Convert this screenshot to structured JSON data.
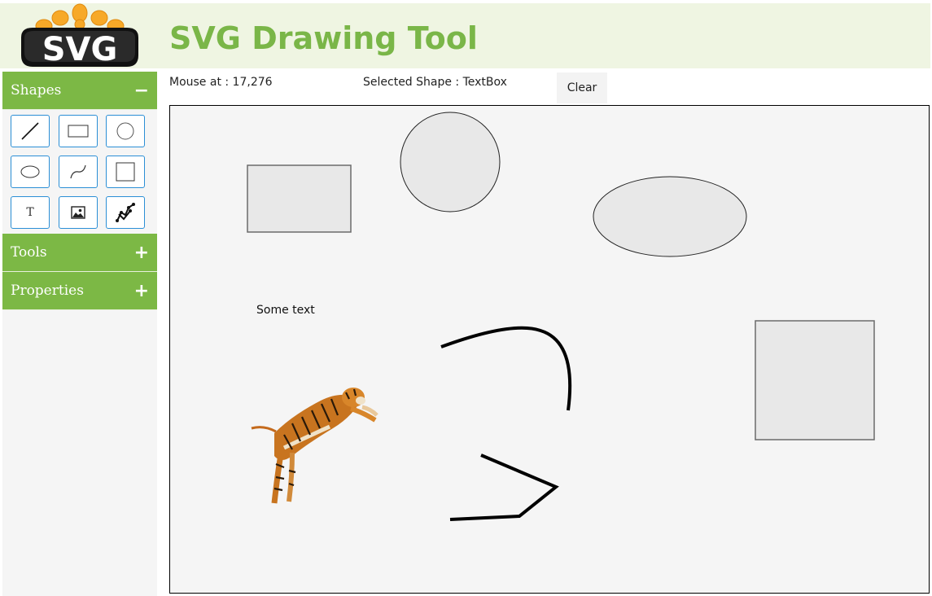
{
  "header": {
    "logo_text": "SVG",
    "title": "SVG Drawing Tool"
  },
  "sidebar": {
    "shapes": {
      "label": "Shapes",
      "toggle": "−",
      "buttons": [
        {
          "name": "line",
          "icon": "line-icon"
        },
        {
          "name": "rectangle",
          "icon": "rectangle-icon"
        },
        {
          "name": "circle",
          "icon": "circle-icon"
        },
        {
          "name": "ellipse",
          "icon": "ellipse-icon"
        },
        {
          "name": "curve",
          "icon": "curve-icon"
        },
        {
          "name": "square",
          "icon": "square-icon"
        },
        {
          "name": "text",
          "icon": "text-icon",
          "glyph": "T"
        },
        {
          "name": "image",
          "icon": "image-icon"
        },
        {
          "name": "polyline",
          "icon": "polyline-icon"
        }
      ]
    },
    "tools": {
      "label": "Tools",
      "toggle": "+"
    },
    "properties": {
      "label": "Properties",
      "toggle": "+"
    }
  },
  "toolbar": {
    "mouse_status": "Mouse at : 17,276",
    "selected_shape": "Selected Shape : TextBox",
    "clear_label": "Clear"
  },
  "canvas": {
    "text_shape": "Some text",
    "colors": {
      "shape_fill": "#e8e8e8",
      "shape_stroke": "#6b6b6b",
      "background": "#f5f5f5"
    }
  },
  "colors": {
    "accent": "#7cb845",
    "header_bg": "#eff5e2",
    "title": "#7ab648",
    "button_border": "#2b8fd6"
  }
}
